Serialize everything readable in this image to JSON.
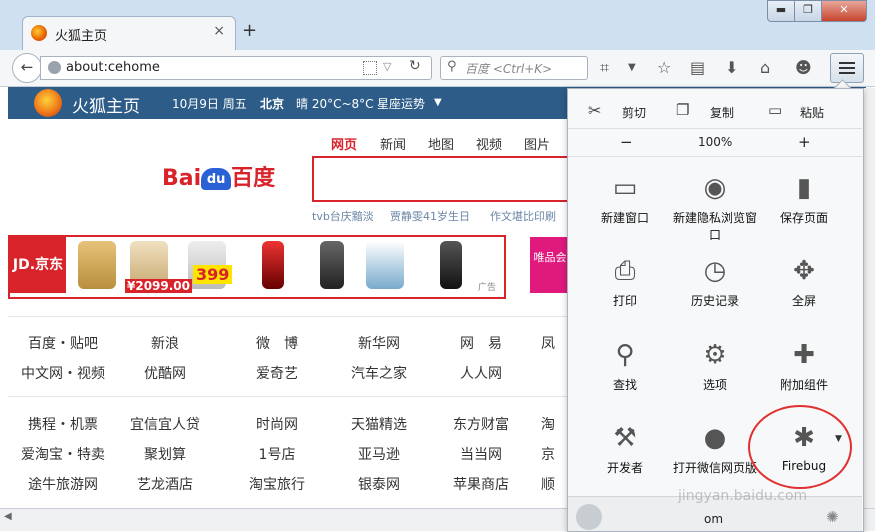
{
  "tab": {
    "title": "火狐主页",
    "close": "×"
  },
  "newtab": "+",
  "window": {
    "min": "▬",
    "max": "❐",
    "close": "✕"
  },
  "nav": {
    "url": "about:cehome",
    "search_placeholder": "百度 <Ctrl+K>"
  },
  "foxbar": {
    "title": "火狐主页",
    "date": "10月9日 周五",
    "city": "北京",
    "weather": "晴 20°C~8°C",
    "horoscope": "星座运势"
  },
  "baidu": {
    "logo_left": "Bai",
    "logo_du": "du",
    "logo_right": "百度",
    "tabs": [
      "网页",
      "新闻",
      "地图",
      "视频",
      "图片"
    ],
    "hot": [
      "tvb台庆黯淡",
      "贾静雯41岁生日",
      "作文堪比印刷"
    ]
  },
  "ads": {
    "jd": "JD.京东",
    "price1": "¥2099.00",
    "price2": "399",
    "vip": "唯品会",
    "ad_label": "广告"
  },
  "links": [
    [
      "百度・贴吧",
      "新浪",
      "微　博",
      "新华网",
      "网　易",
      "凤"
    ],
    [
      "中文网・视频",
      "优酷网",
      "爱奇艺",
      "汽车之家",
      "人人网",
      ""
    ],
    [
      "携程・机票",
      "宜信宜人贷",
      "时尚网",
      "天猫精选",
      "东方财富",
      "淘"
    ],
    [
      "爱淘宝・特卖",
      "聚划算",
      "1号店",
      "亚马逊",
      "当当网",
      "京"
    ],
    [
      "途牛旅游网",
      "艺龙酒店",
      "淘宝旅行",
      "银泰网",
      "苹果商店",
      "顺"
    ]
  ],
  "menu": {
    "cut": "剪切",
    "copy": "复制",
    "paste": "粘贴",
    "zoom_out": "−",
    "zoom": "100%",
    "zoom_in": "+",
    "items": [
      {
        "label": "新建窗口",
        "icon": "window-icon"
      },
      {
        "label": "新建隐私浏览窗口",
        "icon": "mask-icon"
      },
      {
        "label": "保存页面",
        "icon": "page-icon"
      },
      {
        "label": "打印",
        "icon": "printer-icon"
      },
      {
        "label": "历史记录",
        "icon": "clock-icon"
      },
      {
        "label": "全屏",
        "icon": "fullscreen-icon"
      },
      {
        "label": "查找",
        "icon": "magnifier-icon"
      },
      {
        "label": "选项",
        "icon": "gear-icon"
      },
      {
        "label": "附加组件",
        "icon": "puzzle-icon"
      },
      {
        "label": "开发者",
        "icon": "wrench-icon"
      },
      {
        "label": "打开微信网页版",
        "icon": "chat-icon"
      },
      {
        "label": "Firebug",
        "icon": "bug-icon"
      }
    ],
    "account_text": "om"
  },
  "watermark": "jingyan.baidu.com"
}
